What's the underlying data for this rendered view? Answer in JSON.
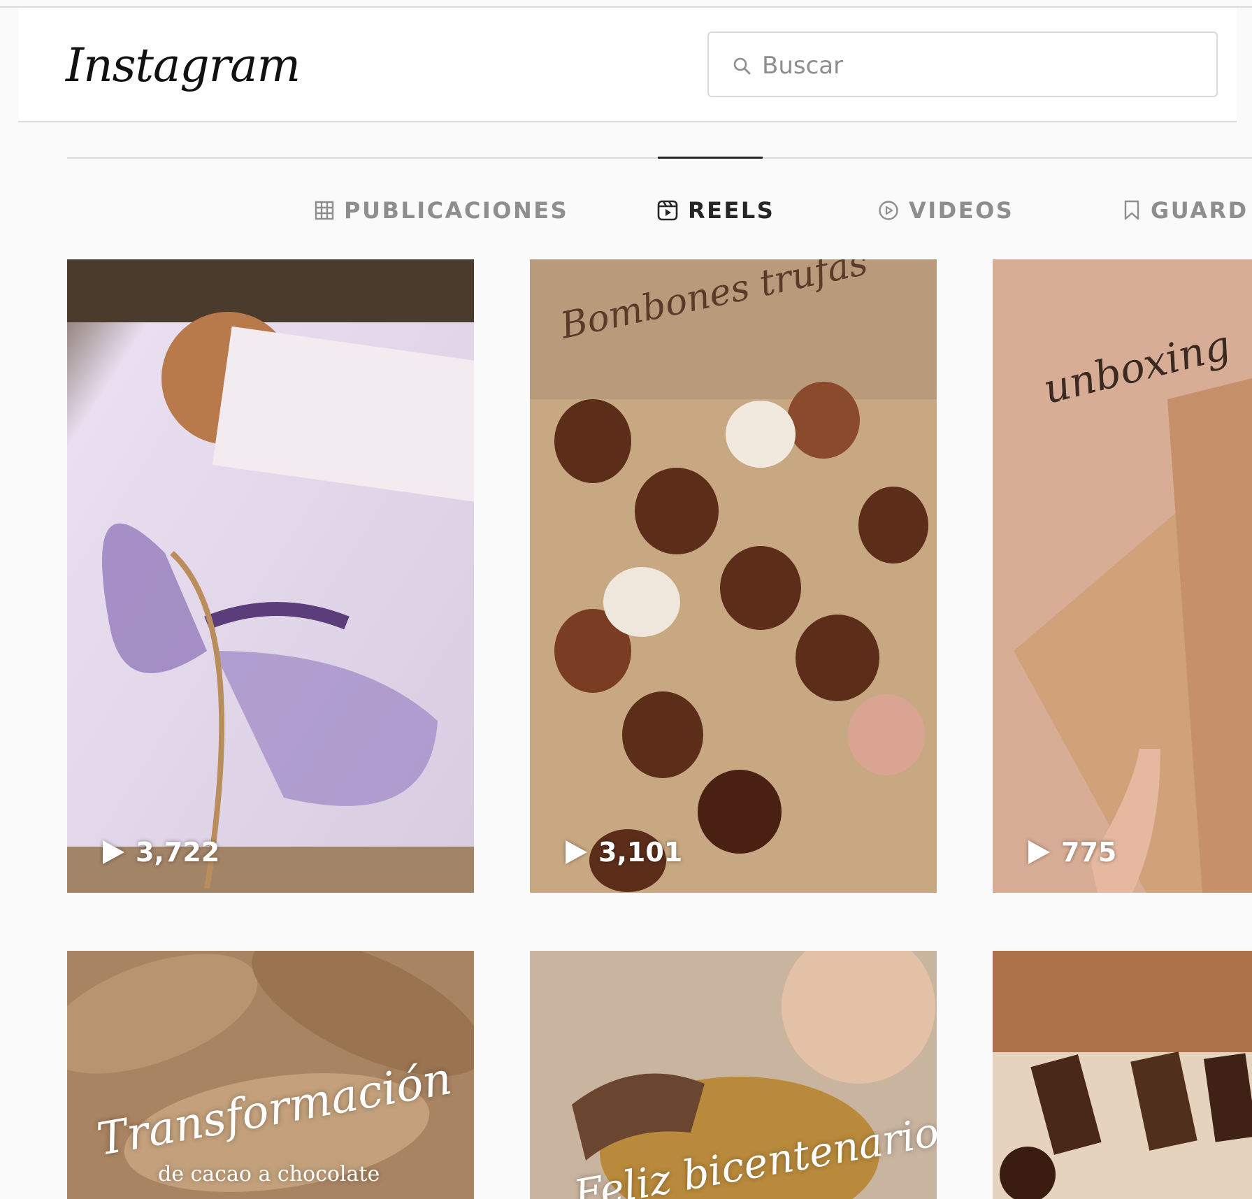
{
  "header": {
    "logo": "Instagram",
    "search_placeholder": "Buscar"
  },
  "tabs": [
    {
      "label": "PUBLICACIONES",
      "icon": "grid-icon",
      "active": false
    },
    {
      "label": "REELS",
      "icon": "reels-icon",
      "active": true
    },
    {
      "label": "VIDEOS",
      "icon": "play-circle-icon",
      "active": false
    },
    {
      "label": "GUARD",
      "icon": "bookmark-icon",
      "active": false
    }
  ],
  "reels": [
    {
      "views": "3,722",
      "overlay_text": "",
      "colors": [
        "#cbb5cf",
        "#8a6fa8",
        "#b8956a"
      ]
    },
    {
      "views": "3,101",
      "overlay_text": "Bombones trufas",
      "colors": [
        "#c7a57d",
        "#5a2f1c",
        "#8b5a3c"
      ]
    },
    {
      "views": "775",
      "overlay_text": "unboxing",
      "colors": [
        "#d4a98f",
        "#b98d6e",
        "#e2c2a8"
      ]
    },
    {
      "views": "",
      "overlay_text": "Transformación",
      "overlay_subtext": "de cacao a chocolate",
      "colors": [
        "#a6805a",
        "#7d5a3b",
        "#c4a07c"
      ]
    },
    {
      "views": "",
      "overlay_text": "Feliz bicentenario",
      "colors": [
        "#cdb8a3",
        "#7a5b3c",
        "#d9a86b"
      ]
    },
    {
      "views": "",
      "overlay_text": "",
      "colors": [
        "#b0744c",
        "#e8d6c0",
        "#4a2a1a"
      ]
    }
  ],
  "colors": {
    "background": "#fafafa",
    "border": "#dbdbdb",
    "tab_active": "#262626",
    "tab_inactive": "#8e8e8e"
  }
}
